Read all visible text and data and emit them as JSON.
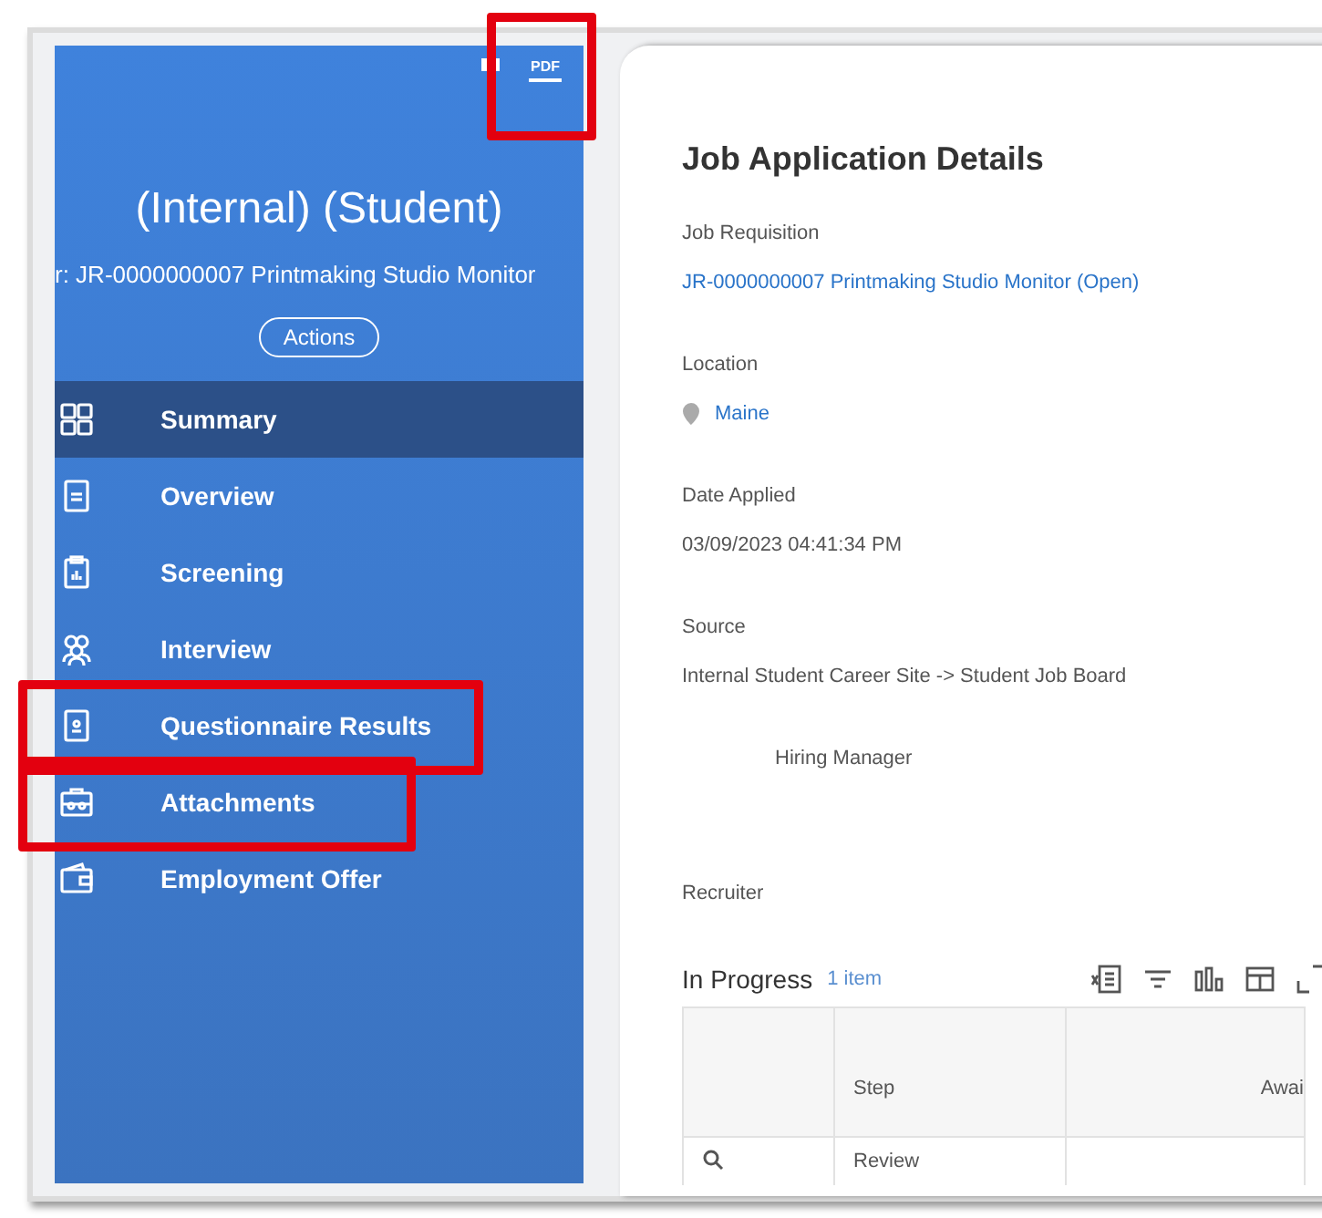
{
  "sidebar": {
    "pdf_button": {
      "label": "PDF",
      "annotated": true
    },
    "title": "(Internal) (Student)",
    "subtitle": "r: JR-0000000007 Printmaking Studio Monitor",
    "actions_button": "Actions",
    "items": [
      {
        "label": "Summary",
        "kind": "grid",
        "selected": true,
        "annotated": false
      },
      {
        "label": "Overview",
        "kind": "doc",
        "selected": false,
        "annotated": false
      },
      {
        "label": "Screening",
        "kind": "clipboard",
        "selected": false,
        "annotated": false
      },
      {
        "label": "Interview",
        "kind": "people",
        "selected": false,
        "annotated": false
      },
      {
        "label": "Questionnaire Results",
        "kind": "badge",
        "selected": false,
        "annotated": true
      },
      {
        "label": "Attachments",
        "kind": "briefcase",
        "selected": false,
        "annotated": true
      },
      {
        "label": "Employment Offer",
        "kind": "wallet",
        "selected": false,
        "annotated": false
      }
    ]
  },
  "details": {
    "title": "Job Application Details",
    "fields": [
      {
        "label": "Job Requisition",
        "value": "JR-0000000007 Printmaking Studio Monitor (Open)",
        "kind": "link"
      },
      {
        "label": "Location",
        "value": "Maine",
        "kind": "location"
      },
      {
        "label": "Date Applied",
        "value": "03/09/2023 04:41:34 PM",
        "kind": "text"
      },
      {
        "label": "Source",
        "value": "Internal Student Career Site -> Student Job Board",
        "kind": "text"
      }
    ],
    "roles": [
      {
        "label": "Hiring Manager",
        "kind": "indented"
      },
      {
        "label": "Recruiter",
        "kind": "plain"
      }
    ],
    "in_progress": {
      "title": "In Progress",
      "count": "1 item",
      "columns": [
        "Step",
        "Awai"
      ],
      "rows": [
        {
          "step": "Review"
        }
      ]
    }
  }
}
